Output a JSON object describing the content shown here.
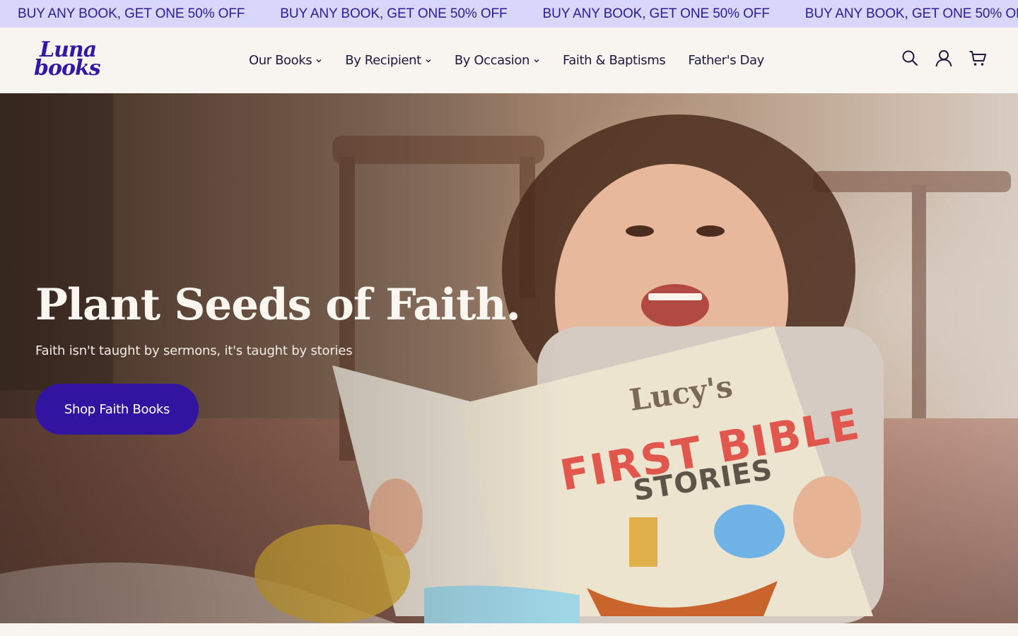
{
  "announcement": {
    "items": [
      "BUY ANY BOOK, GET ONE 50% OFF",
      "BUY ANY BOOK, GET ONE 50% OFF",
      "BUY ANY BOOK, GET ONE 50% OFF",
      "BUY ANY BOOK, GET ONE 50% OFF"
    ]
  },
  "header": {
    "logo": {
      "line1": "Luna",
      "line2": "books"
    },
    "nav": [
      {
        "label": "Our Books",
        "dropdown": true
      },
      {
        "label": "By Recipient",
        "dropdown": true
      },
      {
        "label": "By Occasion",
        "dropdown": true
      },
      {
        "label": "Faith & Baptisms",
        "dropdown": false
      },
      {
        "label": "Father's Day",
        "dropdown": false
      }
    ],
    "icons": [
      "search-icon",
      "account-icon",
      "cart-icon"
    ]
  },
  "hero": {
    "title": "Plant Seeds of Faith.",
    "subtitle": "Faith isn't taught by sermons, it's taught by stories",
    "cta_label": "Shop Faith Books",
    "book": {
      "name": "Lucy's",
      "line1": "FIRST BIBLE",
      "line2": "STORIES"
    }
  },
  "colors": {
    "announcement_bg": "#d9d6fb",
    "announcement_text": "#2a1b9c",
    "brand": "#2f1aa6",
    "cta_bg": "#3115a0",
    "header_bg": "#f8f5f1"
  }
}
